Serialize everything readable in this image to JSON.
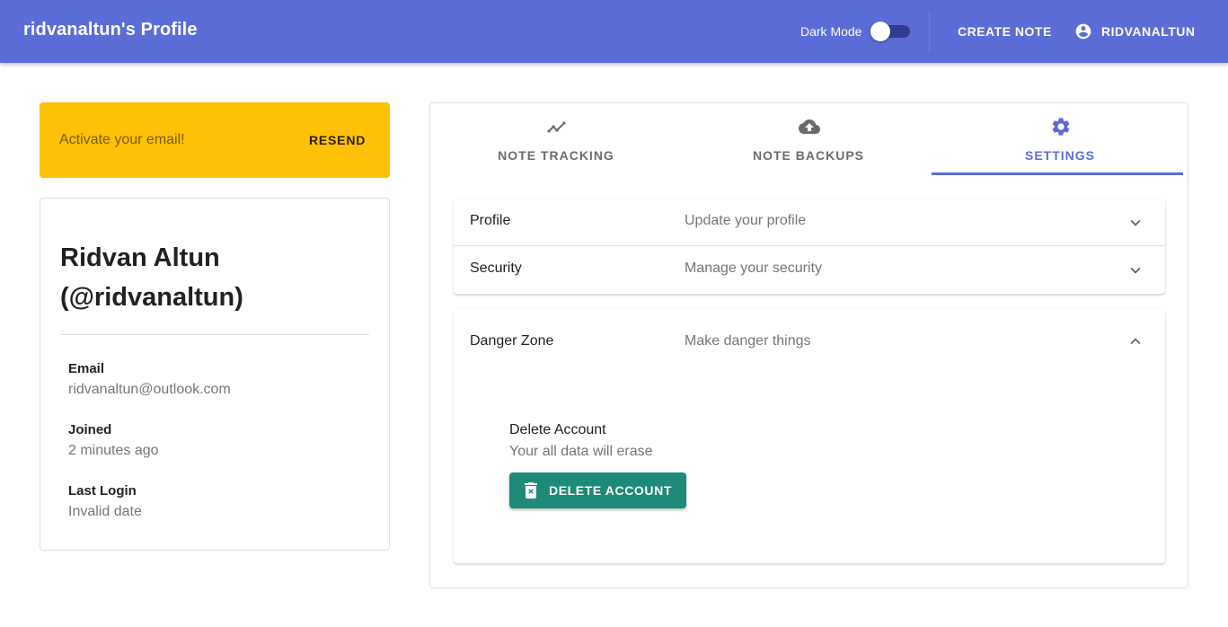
{
  "appbar": {
    "title": "ridvanaltun's Profile",
    "dark_mode_label": "Dark Mode",
    "dark_mode_on": false,
    "create_note_label": "CREATE NOTE",
    "user_label": "RIDVANALTUN",
    "color": "#5a6dd6"
  },
  "alert": {
    "message": "Activate your email!",
    "action_label": "RESEND",
    "color": "#ffc107"
  },
  "profile": {
    "full_name": "Ridvan Altun",
    "handle": "(@ridvanaltun)",
    "fields": [
      {
        "label": "Email",
        "value": "ridvanaltun@outlook.com"
      },
      {
        "label": "Joined",
        "value": "2 minutes ago"
      },
      {
        "label": "Last Login",
        "value": "Invalid date"
      }
    ]
  },
  "tabs": [
    {
      "label": "NOTE TRACKING",
      "icon": "trending-icon",
      "active": false
    },
    {
      "label": "NOTE BACKUPS",
      "icon": "cloud-upload-icon",
      "active": false
    },
    {
      "label": "SETTINGS",
      "icon": "gear-icon",
      "active": true
    }
  ],
  "settings": {
    "sections": [
      {
        "heading": "Profile",
        "summary": "Update your profile",
        "expanded": false
      },
      {
        "heading": "Security",
        "summary": "Manage your security",
        "expanded": false
      },
      {
        "heading": "Danger Zone",
        "summary": "Make danger things",
        "expanded": true
      }
    ],
    "danger_zone": {
      "title": "Delete Account",
      "description": "Your all data will erase",
      "button_label": "DELETE ACCOUNT",
      "button_color": "#1e8a7a"
    }
  }
}
